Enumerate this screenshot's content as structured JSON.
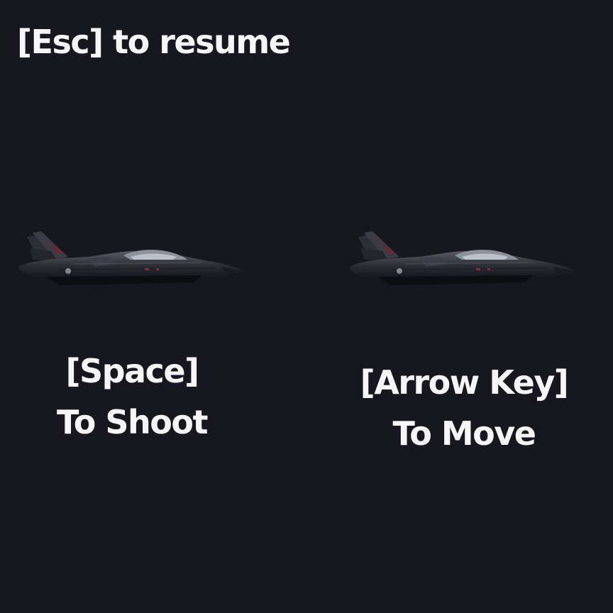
{
  "screen": {
    "background": "#171720",
    "text_color": "#f6f6f8",
    "resume_hint": "[Esc] to resume",
    "shoot_instruction": {
      "key": "[Space]",
      "action": "To Shoot",
      "icon": "fighter-jet-icon"
    },
    "move_instruction": {
      "key": "[Arrow Key]",
      "action": "To Move",
      "icon": "fighter-jet-icon"
    }
  }
}
